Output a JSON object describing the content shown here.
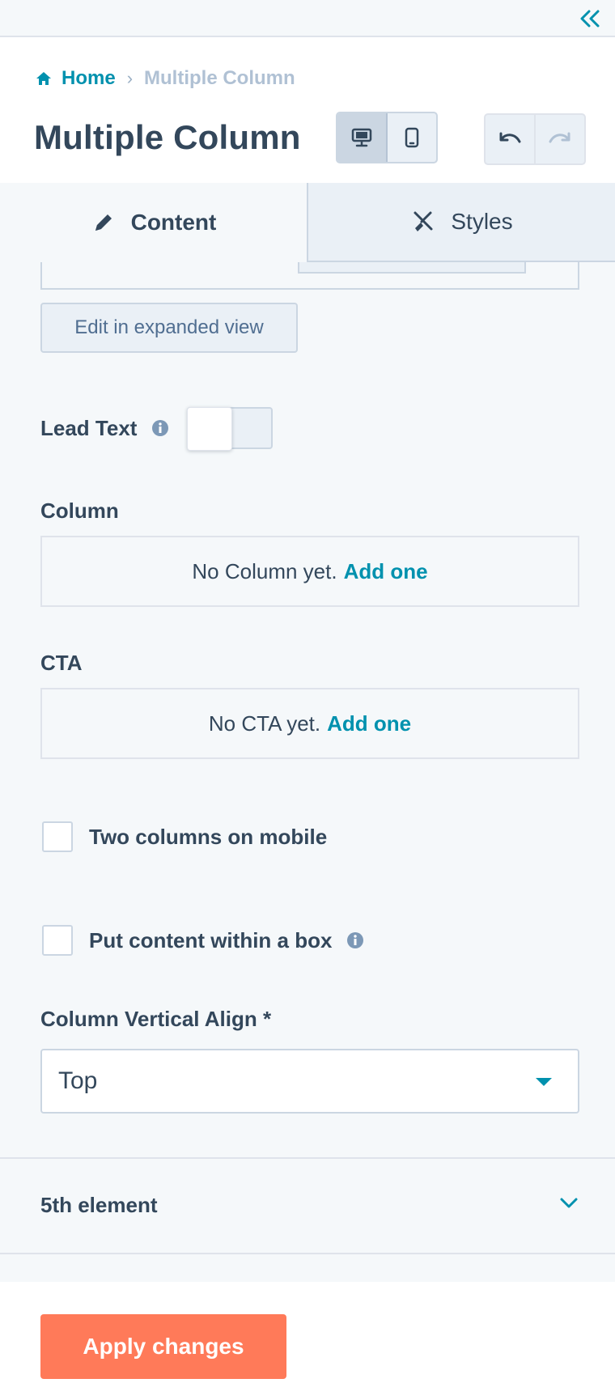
{
  "app": {
    "collapse_icon": "double-chevron-left-icon"
  },
  "breadcrumb": {
    "home_icon": "home-icon",
    "home_label": "Home",
    "separator": "›",
    "current_label": "Multiple Column"
  },
  "header": {
    "title": "Multiple Column",
    "view_toggle": [
      {
        "icon": "desktop-icon",
        "active": true
      },
      {
        "icon": "mobile-icon",
        "active": false
      }
    ],
    "history": [
      {
        "icon": "undo-icon",
        "enabled": true
      },
      {
        "icon": "redo-icon",
        "enabled": false
      }
    ]
  },
  "tabs": [
    {
      "label": "Content",
      "icon": "pencil-icon",
      "active": true
    },
    {
      "label": "Styles",
      "icon": "brush-icon",
      "active": false
    }
  ],
  "content": {
    "expanded_view_button": "Edit in expanded view",
    "lead_text": {
      "label": "Lead Text",
      "info_icon": "info-icon",
      "enabled": false
    },
    "column": {
      "label": "Column",
      "empty_text": "No Column yet.",
      "add_label": "Add one"
    },
    "cta": {
      "label": "CTA",
      "empty_text": "No CTA yet.",
      "add_label": "Add one"
    },
    "two_columns_mobile": {
      "label": "Two columns on mobile",
      "checked": false
    },
    "content_in_box": {
      "label": "Put content within a box",
      "info_icon": "info-icon",
      "checked": false
    },
    "vertical_align": {
      "label": "Column Vertical Align *",
      "value": "Top",
      "caret_icon": "caret-down-icon"
    },
    "accordion": {
      "label": "5th element",
      "chevron_icon": "chevron-down-icon"
    }
  },
  "footer": {
    "apply_label": "Apply changes"
  },
  "colors": {
    "accent": "#0091ae",
    "primary_button": "#ff7a59",
    "text": "#33475b",
    "muted_text": "#b0c1d4",
    "panel_bg": "#f5f8fa",
    "border": "#cbd6e2"
  }
}
